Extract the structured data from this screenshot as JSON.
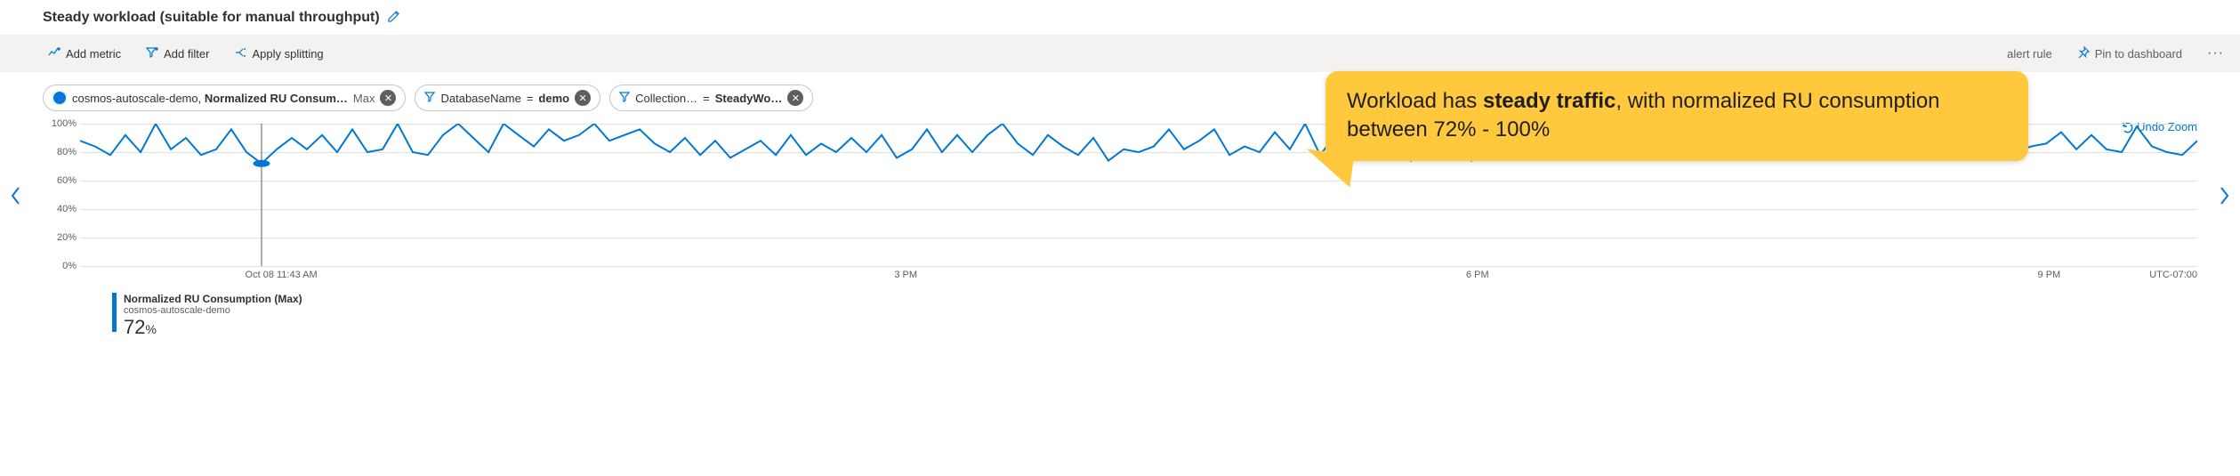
{
  "title": "Steady workload (suitable for manual throughput)",
  "toolbar": {
    "add_metric": "Add metric",
    "add_filter": "Add filter",
    "apply_splitting": "Apply splitting",
    "alert_rule": "alert rule",
    "pin_dashboard": "Pin to dashboard"
  },
  "pills": {
    "metric": {
      "resource": "cosmos-autoscale-demo, ",
      "metric_name": "Normalized RU Consum…",
      "aggregation": "Max"
    },
    "filter1": {
      "key": "DatabaseName",
      "value": "demo"
    },
    "filter2": {
      "key": "Collection…",
      "value": "SteadyWo…"
    }
  },
  "undo_zoom": "Undo Zoom",
  "legend": {
    "line1": "Normalized RU Consumption (Max)",
    "line2": "cosmos-autoscale-demo",
    "value": "72",
    "unit": "%"
  },
  "callout": {
    "prefix": "Workload has ",
    "bold": "steady traffic",
    "suffix": ", with normalized RU consumption between 72% - 100%"
  },
  "chart_data": {
    "type": "line",
    "ylabel": "",
    "y_ticks": [
      "0%",
      "20%",
      "40%",
      "60%",
      "80%",
      "100%"
    ],
    "ylim": [
      0,
      100
    ],
    "x_ticks": [
      "Oct 08 11:43 AM",
      "3 PM",
      "6 PM",
      "9 PM"
    ],
    "x_tick_positions": [
      0.095,
      0.39,
      0.66,
      0.93
    ],
    "tz": "UTC-07:00",
    "marker_index": 12,
    "series": [
      {
        "name": "Normalized RU Consumption (Max)",
        "color": "#0078d4",
        "values": [
          88,
          84,
          78,
          92,
          80,
          100,
          82,
          90,
          78,
          82,
          96,
          80,
          72,
          82,
          90,
          82,
          92,
          80,
          96,
          80,
          82,
          100,
          80,
          78,
          92,
          100,
          90,
          80,
          100,
          92,
          84,
          96,
          88,
          92,
          100,
          88,
          92,
          96,
          86,
          80,
          90,
          78,
          88,
          76,
          82,
          88,
          78,
          92,
          78,
          86,
          80,
          90,
          80,
          92,
          76,
          82,
          96,
          80,
          92,
          80,
          92,
          100,
          86,
          78,
          92,
          84,
          78,
          90,
          74,
          82,
          80,
          84,
          96,
          82,
          88,
          96,
          78,
          84,
          80,
          94,
          82,
          100,
          78,
          92,
          88,
          92,
          78,
          84,
          74,
          84,
          92,
          84,
          74,
          80,
          86,
          80,
          100,
          84,
          80,
          100,
          80,
          92,
          86,
          96,
          78,
          88,
          80,
          98,
          84,
          100,
          84,
          90,
          86,
          80,
          92,
          86,
          90,
          76,
          88,
          84,
          78,
          86,
          80,
          92,
          84,
          78,
          82,
          88,
          80,
          84,
          86,
          94,
          82,
          92,
          82,
          80,
          98,
          84,
          80,
          78,
          88
        ]
      }
    ]
  }
}
